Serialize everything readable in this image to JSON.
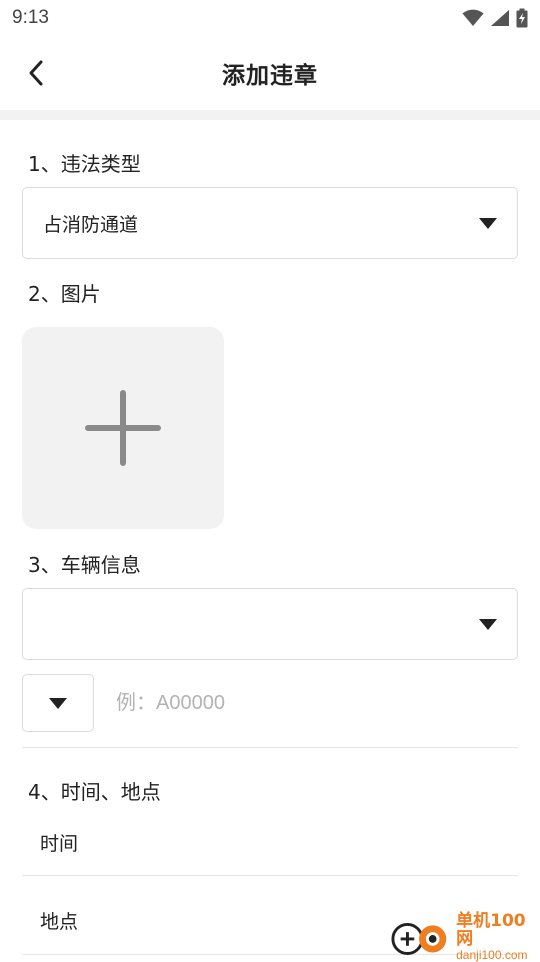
{
  "status_bar": {
    "time": "9:13",
    "icons": [
      "wifi-icon",
      "signal-icon",
      "battery-charging-icon"
    ]
  },
  "header": {
    "title": "添加违章",
    "back_icon": "chevron-left-icon"
  },
  "sections": {
    "violation_type": {
      "label": "1、违法类型",
      "selected": "占消防通道"
    },
    "image": {
      "label": "2、图片",
      "add_icon": "plus-icon"
    },
    "vehicle": {
      "label": "3、车辆信息",
      "selected": "",
      "plate_prefix": "",
      "plate_placeholder": "例：A00000"
    },
    "time_place": {
      "label": "4、时间、地点",
      "time_label": "时间",
      "place_label": "地点"
    }
  },
  "watermark": {
    "name": "单机100网",
    "url": "danji100.com"
  },
  "colors": {
    "accent": "#f07d1f",
    "border": "#dcdcdc",
    "placeholder": "#b3b3b3",
    "photo_bg": "#f2f2f2"
  }
}
